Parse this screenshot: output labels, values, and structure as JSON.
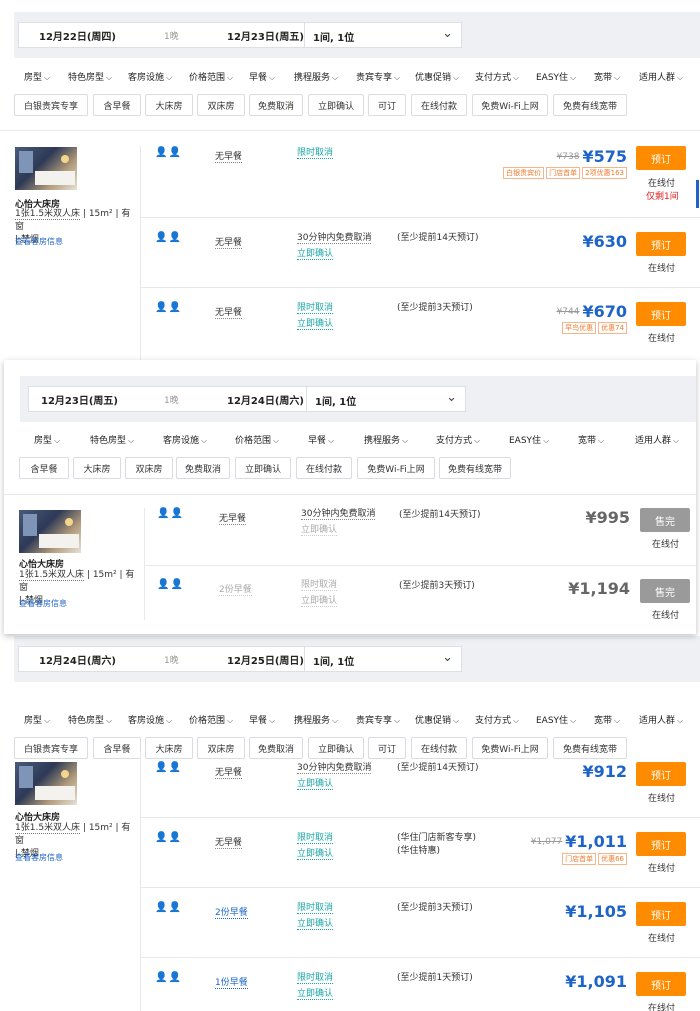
{
  "screens": [
    {
      "checkin": "12月22日(周四)",
      "nights": "1晚",
      "checkout": "12月23日(周五)",
      "rooms_guests": "1间, 1位",
      "filters": [
        "房型",
        "特色房型",
        "客房设施",
        "价格范围",
        "早餐",
        "携程服务",
        "贵宾专享",
        "优惠促销",
        "支付方式",
        "EASY住",
        "宽带",
        "适用人群"
      ],
      "tags": [
        "白银贵宾专享",
        "含早餐",
        "大床房",
        "双床房",
        "免费取消",
        "立即确认",
        "可订",
        "在线付款",
        "免费Wi-Fi上网",
        "免费有线宽带"
      ],
      "room": {
        "name": "心怡大床房",
        "bed": "1张1.5米双人床",
        "area": "15m²",
        "window": "有窗",
        "smoking": "禁烟",
        "link": "查看客房信息"
      },
      "rates": [
        {
          "meal": "无早餐",
          "policy": [
            "限时取消"
          ],
          "cond": "",
          "old_price": "¥738",
          "price": "¥575",
          "badges": [
            "白银贵宾价",
            "门店首单",
            "2项优惠163"
          ],
          "book": "预订",
          "pay": "在线付",
          "left": "仅剩1间"
        },
        {
          "meal": "无早餐",
          "policy": [
            "30分钟内免费取消",
            "立即确认"
          ],
          "cond": "(至少提前14天预订)",
          "old_price": "",
          "price": "¥630",
          "badges": [],
          "book": "预订",
          "pay": "在线付",
          "left": ""
        },
        {
          "meal": "无早餐",
          "policy": [
            "限时取消",
            "立即确认"
          ],
          "cond": "(至少提前3天预订)",
          "old_price": "¥744",
          "price": "¥670",
          "badges": [
            "早鸟优惠",
            "优惠74"
          ],
          "book": "预订",
          "pay": "在线付",
          "left": ""
        }
      ]
    },
    {
      "checkin": "12月23日(周五)",
      "nights": "1晚",
      "checkout": "12月24日(周六)",
      "rooms_guests": "1间, 1位",
      "filters": [
        "房型",
        "特色房型",
        "客房设施",
        "价格范围",
        "早餐",
        "携程服务",
        "支付方式",
        "EASY住",
        "宽带",
        "适用人群"
      ],
      "tags": [
        "含早餐",
        "大床房",
        "双床房",
        "免费取消",
        "立即确认",
        "在线付款",
        "免费Wi-Fi上网",
        "免费有线宽带"
      ],
      "room": {
        "name": "心怡大床房",
        "bed": "1张1.5米双人床",
        "area": "15m²",
        "window": "有窗",
        "smoking": "禁烟",
        "link": "查看客房信息"
      },
      "rates": [
        {
          "meal": "无早餐",
          "policy": [
            "30分钟内免费取消",
            "立即确认"
          ],
          "cond": "(至少提前14天预订)",
          "old_price": "",
          "price": "¥995",
          "badges": [],
          "book": "售完",
          "pay": "在线付",
          "left": ""
        },
        {
          "meal": "2份早餐",
          "policy": [
            "限时取消",
            "立即确认"
          ],
          "cond": "(至少提前3天预订)",
          "old_price": "",
          "price": "¥1,194",
          "badges": [],
          "book": "售完",
          "pay": "在线付",
          "left": ""
        }
      ]
    },
    {
      "checkin": "12月24日(周六)",
      "nights": "1晚",
      "checkout": "12月25日(周日)",
      "rooms_guests": "1间, 1位",
      "filters": [
        "房型",
        "特色房型",
        "客房设施",
        "价格范围",
        "早餐",
        "携程服务",
        "贵宾专享",
        "优惠促销",
        "支付方式",
        "EASY住",
        "宽带",
        "适用人群"
      ],
      "tags": [
        "白银贵宾专享",
        "含早餐",
        "大床房",
        "双床房",
        "免费取消",
        "立即确认",
        "可订",
        "在线付款",
        "免费Wi-Fi上网",
        "免费有线宽带"
      ],
      "room": {
        "name": "心怡大床房",
        "bed": "1张1.5米双人床",
        "area": "15m²",
        "window": "有窗",
        "smoking": "禁烟",
        "link": "查看客房信息"
      },
      "rates": [
        {
          "meal": "无早餐",
          "policy": [
            "30分钟内免费取消",
            "立即确认"
          ],
          "cond": "(至少提前14天预订)",
          "old_price": "",
          "price": "¥912",
          "badges": [],
          "book": "预订",
          "pay": "在线付",
          "left": ""
        },
        {
          "meal": "无早餐",
          "policy": [
            "限时取消",
            "立即确认"
          ],
          "cond": "(华住门店新客专享)(华住特惠)",
          "old_price": "¥1,077",
          "price": "¥1,011",
          "badges": [
            "门店首单",
            "优惠66"
          ],
          "book": "预订",
          "pay": "在线付",
          "left": ""
        },
        {
          "meal": "2份早餐",
          "policy": [
            "限时取消",
            "立即确认"
          ],
          "cond": "(至少提前3天预订)",
          "old_price": "",
          "price": "¥1,105",
          "badges": [],
          "book": "预订",
          "pay": "在线付",
          "left": ""
        },
        {
          "meal": "1份早餐",
          "policy": [
            "限时取消",
            "立即确认"
          ],
          "cond": "(至少提前1天预订)",
          "old_price": "",
          "price": "¥1,091",
          "badges": [],
          "book": "预订",
          "pay": "在线付",
          "left": ""
        }
      ]
    }
  ]
}
